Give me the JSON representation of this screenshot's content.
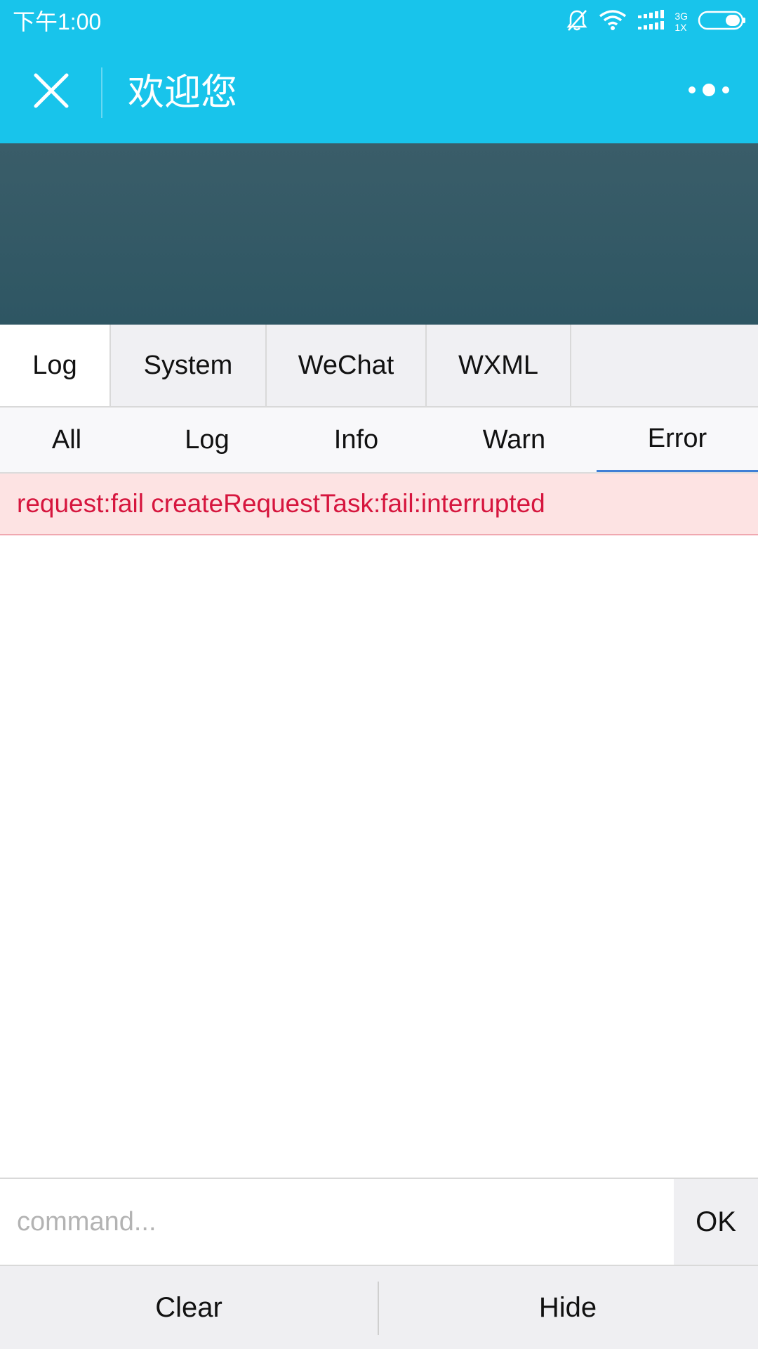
{
  "status_bar": {
    "time": "下午1:00",
    "network_top": "3G",
    "network_bottom": "1X",
    "icons": [
      "bell-off-icon",
      "wifi-icon",
      "signal-icon",
      "signal-icon",
      "battery-icon"
    ]
  },
  "title_bar": {
    "title": "欢迎您",
    "close_icon": "close-icon",
    "more_icon": "more-dots-icon"
  },
  "main_tabs": [
    "Log",
    "System",
    "WeChat",
    "WXML"
  ],
  "filter_tabs": [
    "All",
    "Log",
    "Info",
    "Warn",
    "Error"
  ],
  "active_main_tab": "Log",
  "active_filter_tab": "Error",
  "log": {
    "error_message": "request:fail createRequestTask:fail:interrupted"
  },
  "command": {
    "placeholder": "command...",
    "ok_label": "OK"
  },
  "bottom": {
    "clear_label": "Clear",
    "hide_label": "Hide"
  },
  "colors": {
    "header": "#18c4eb",
    "banner": "#34606b",
    "error_text": "#d6163e",
    "error_bg": "#fde3e3",
    "active_tab_underline": "#3f7fd6"
  }
}
